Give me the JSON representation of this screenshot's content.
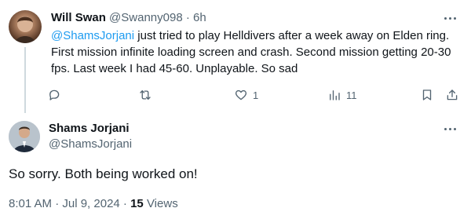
{
  "reply_tweet": {
    "author_name": "Will Swan",
    "author_handle": "@Swanny098",
    "separator": "·",
    "time": "6h",
    "mention": "@ShamsJorjani",
    "text": " just tried to play Helldivers after a week away on Elden ring. First mission infinite loading screen and crash. Second mission getting 20-30 fps. Last week I had 45-60. Unplayable. So sad",
    "actions": {
      "reply_icon": "comment-icon",
      "repost_icon": "repost-icon",
      "like_icon": "heart-icon",
      "like_count": "1",
      "views_icon": "analytics-icon",
      "views_count": "11",
      "bookmark_icon": "bookmark-icon",
      "share_icon": "share-icon"
    }
  },
  "main_tweet": {
    "author_name": "Shams Jorjani",
    "author_handle": "@ShamsJorjani",
    "text": "So sorry. Both being worked on!",
    "timestamp": "8:01 AM · Jul 9, 2024 · ",
    "views_count": "15",
    "views_label": " Views"
  },
  "colors": {
    "link": "#1d9bf0",
    "secondary_text": "#536471",
    "primary_text": "#0f1419",
    "thread_line": "#cfd9de"
  }
}
